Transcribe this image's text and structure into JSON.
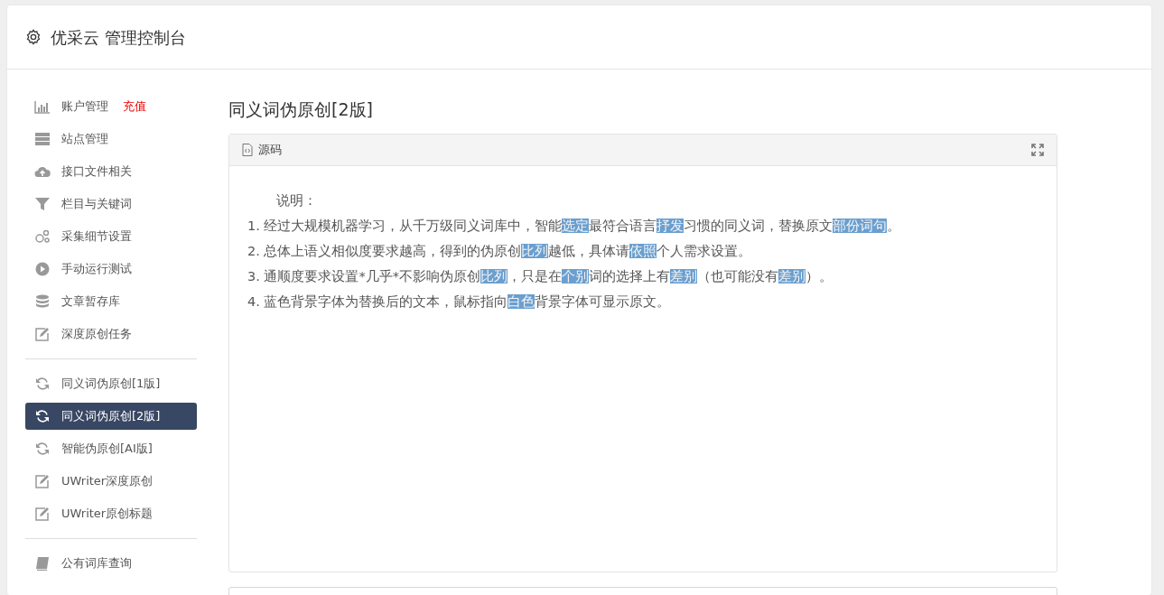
{
  "header": {
    "title": "优采云 管理控制台"
  },
  "sidebar": {
    "groups": [
      [
        {
          "label": "账户管理",
          "badge": "充值",
          "selected": false
        },
        {
          "label": "站点管理",
          "selected": false
        },
        {
          "label": "接口文件相关",
          "selected": false
        },
        {
          "label": "栏目与关键词",
          "selected": false
        },
        {
          "label": "采集细节设置",
          "selected": false
        },
        {
          "label": "手动运行测试",
          "selected": false
        },
        {
          "label": "文章暂存库",
          "selected": false
        },
        {
          "label": "深度原创任务",
          "selected": false
        }
      ],
      [
        {
          "label": "同义词伪原创[1版]",
          "selected": false
        },
        {
          "label": "同义词伪原创[2版]",
          "selected": true
        },
        {
          "label": "智能伪原创[AI版]",
          "selected": false
        },
        {
          "label": "UWriter深度原创",
          "selected": false
        },
        {
          "label": "UWriter原创标题",
          "selected": false
        }
      ],
      [
        {
          "label": "公有词库查询",
          "selected": false
        }
      ]
    ]
  },
  "main": {
    "title": "同义词伪原创[2版]",
    "panel": {
      "header": "源码",
      "intro": "说明：",
      "lines": [
        {
          "number": "1.",
          "segments": [
            {
              "text": "经过大规模机器学习，从千万级同义词库中，智能",
              "replaced": false
            },
            {
              "text": "选定",
              "replaced": true
            },
            {
              "text": "最符合语言",
              "replaced": false
            },
            {
              "text": "抒发",
              "replaced": true
            },
            {
              "text": "习惯的同义词，替换原文",
              "replaced": false
            },
            {
              "text": "部份",
              "replaced": true
            },
            {
              "text": "词句",
              "replaced": true
            },
            {
              "text": "。",
              "replaced": false
            }
          ]
        },
        {
          "number": "2.",
          "segments": [
            {
              "text": "总体上语义相似度要求越高，得到的伪原创",
              "replaced": false
            },
            {
              "text": "比列",
              "replaced": true
            },
            {
              "text": "越低，具体请",
              "replaced": false
            },
            {
              "text": "依照",
              "replaced": true
            },
            {
              "text": "个人需求设置。",
              "replaced": false
            }
          ]
        },
        {
          "number": "3.",
          "segments": [
            {
              "text": "通顺度要求设置*几乎*不影响伪原创",
              "replaced": false
            },
            {
              "text": "比列",
              "replaced": true
            },
            {
              "text": "，只是在",
              "replaced": false
            },
            {
              "text": "个别",
              "replaced": true
            },
            {
              "text": "词的选择上有",
              "replaced": false
            },
            {
              "text": "差别",
              "replaced": true
            },
            {
              "text": "（也可能没有",
              "replaced": false
            },
            {
              "text": "差别",
              "replaced": true
            },
            {
              "text": "）。",
              "replaced": false
            }
          ]
        },
        {
          "number": "4.",
          "segments": [
            {
              "text": "蓝色背景字体为替换后的文本，鼠标指向",
              "replaced": false
            },
            {
              "text": "白色",
              "replaced": true
            },
            {
              "text": "背景字体可显示原文。",
              "replaced": false
            }
          ]
        }
      ]
    }
  }
}
